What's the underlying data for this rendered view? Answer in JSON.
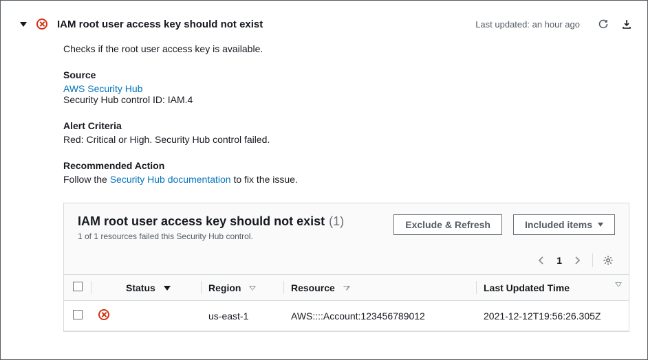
{
  "header": {
    "title": "IAM root user access key should not exist",
    "last_updated": "Last updated: an hour ago"
  },
  "description": "Checks if the root user access key is available.",
  "source": {
    "label": "Source",
    "link_text": "AWS Security Hub",
    "control_id": "Security Hub control ID: IAM.4"
  },
  "alert_criteria": {
    "label": "Alert Criteria",
    "text": "Red: Critical or High. Security Hub control failed."
  },
  "recommended": {
    "label": "Recommended Action",
    "prefix": "Follow the ",
    "link_text": "Security Hub documentation",
    "suffix": " to fix the issue."
  },
  "panel": {
    "title": "IAM root user access key should not exist",
    "count": "(1)",
    "subtitle": "1 of 1 resources failed this Security Hub control.",
    "exclude_btn": "Exclude & Refresh",
    "included_btn": "Included items",
    "page": "1"
  },
  "table": {
    "headers": {
      "status": "Status",
      "region": "Region",
      "resource": "Resource",
      "last_updated": "Last Updated Time"
    },
    "rows": [
      {
        "region": "us-east-1",
        "resource": "AWS::::Account:123456789012",
        "last_updated": "2021-12-12T19:56:26.305Z"
      }
    ]
  }
}
